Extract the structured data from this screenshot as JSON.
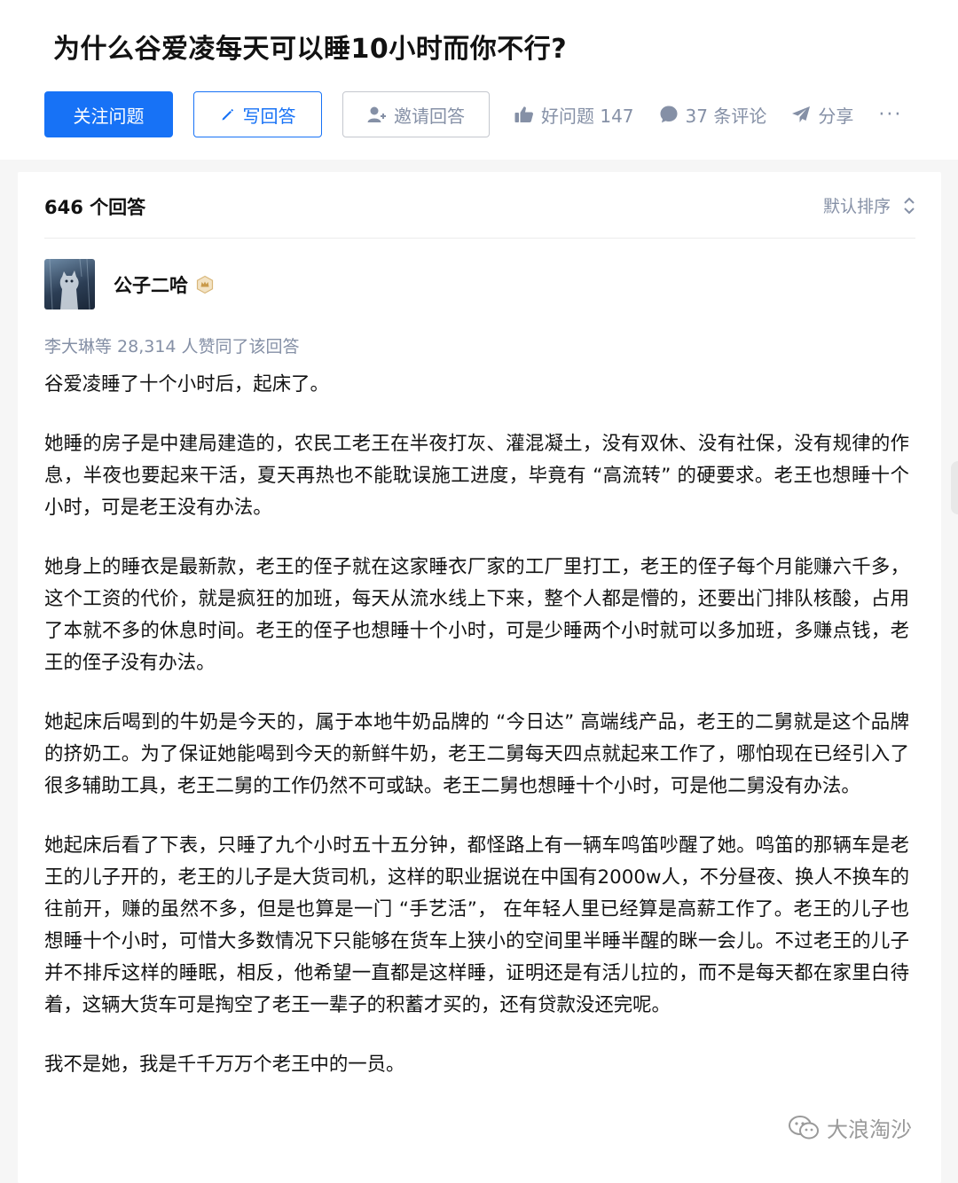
{
  "question": {
    "title": "为什么谷爱凌每天可以睡10小时而你不行?"
  },
  "actions": {
    "follow_label": "关注问题",
    "write_label": "写回答",
    "invite_label": "邀请回答",
    "good_question_label": "好问题 147",
    "comments_label": "37 条评论",
    "share_label": "分享",
    "more_label": "···"
  },
  "answers": {
    "count_label": "646 个回答",
    "sort_label": "默认排序"
  },
  "answer": {
    "author": "公子二哈",
    "votes_text": "李大琳等 28,314 人赞同了该回答",
    "paragraphs": [
      "谷爱凌睡了十个小时后，起床了。",
      "她睡的房子是中建局建造的，农民工老王在半夜打灰、灌混凝土，没有双休、没有社保，没有规律的作息，半夜也要起来干活，夏天再热也不能耽误施工进度，毕竟有 “高流转” 的硬要求。老王也想睡十个小时，可是老王没有办法。",
      "她身上的睡衣是最新款，老王的侄子就在这家睡衣厂家的工厂里打工，老王的侄子每个月能赚六千多，这个工资的代价，就是疯狂的加班，每天从流水线上下来，整个人都是懵的，还要出门排队核酸，占用了本就不多的休息时间。老王的侄子也想睡十个小时，可是少睡两个小时就可以多加班，多赚点钱，老王的侄子没有办法。",
      "她起床后喝到的牛奶是今天的，属于本地牛奶品牌的 “今日达” 高端线产品，老王的二舅就是这个品牌的挤奶工。为了保证她能喝到今天的新鲜牛奶，老王二舅每天四点就起来工作了，哪怕现在已经引入了很多辅助工具，老王二舅的工作仍然不可或缺。老王二舅也想睡十个小时，可是他二舅没有办法。",
      "她起床后看了下表，只睡了九个小时五十五分钟，都怪路上有一辆车鸣笛吵醒了她。鸣笛的那辆车是老王的儿子开的，老王的儿子是大货司机，这样的职业据说在中国有2000w人，不分昼夜、换人不换车的往前开，赚的虽然不多，但是也算是一门 “手艺活”， 在年轻人里已经算是高薪工作了。老王的儿子也想睡十个小时，可惜大多数情况下只能够在货车上狭小的空间里半睡半醒的眯一会儿。不过老王的儿子并不排斥这样的睡眠，相反，他希望一直都是这样睡，证明还是有活儿拉的，而不是每天都在家里白待着，这辆大货车可是掏空了老王一辈子的积蓄才买的，还有贷款没还完呢。",
      "我不是她，我是千千万万个老王中的一员。"
    ]
  },
  "watermark": {
    "text": "大浪淘沙"
  },
  "colors": {
    "brand_blue": "#1772f6",
    "meta_gray": "#8590a6",
    "text_dark": "#121212"
  },
  "icons": {
    "write": "pencil-icon",
    "invite": "add-user-icon",
    "good_question": "thumbs-up-icon",
    "comments": "comment-bubble-icon",
    "share": "paper-plane-icon",
    "sort": "sort-chevron-icon",
    "badge": "creator-badge-icon",
    "watermark": "wechat-icon"
  }
}
